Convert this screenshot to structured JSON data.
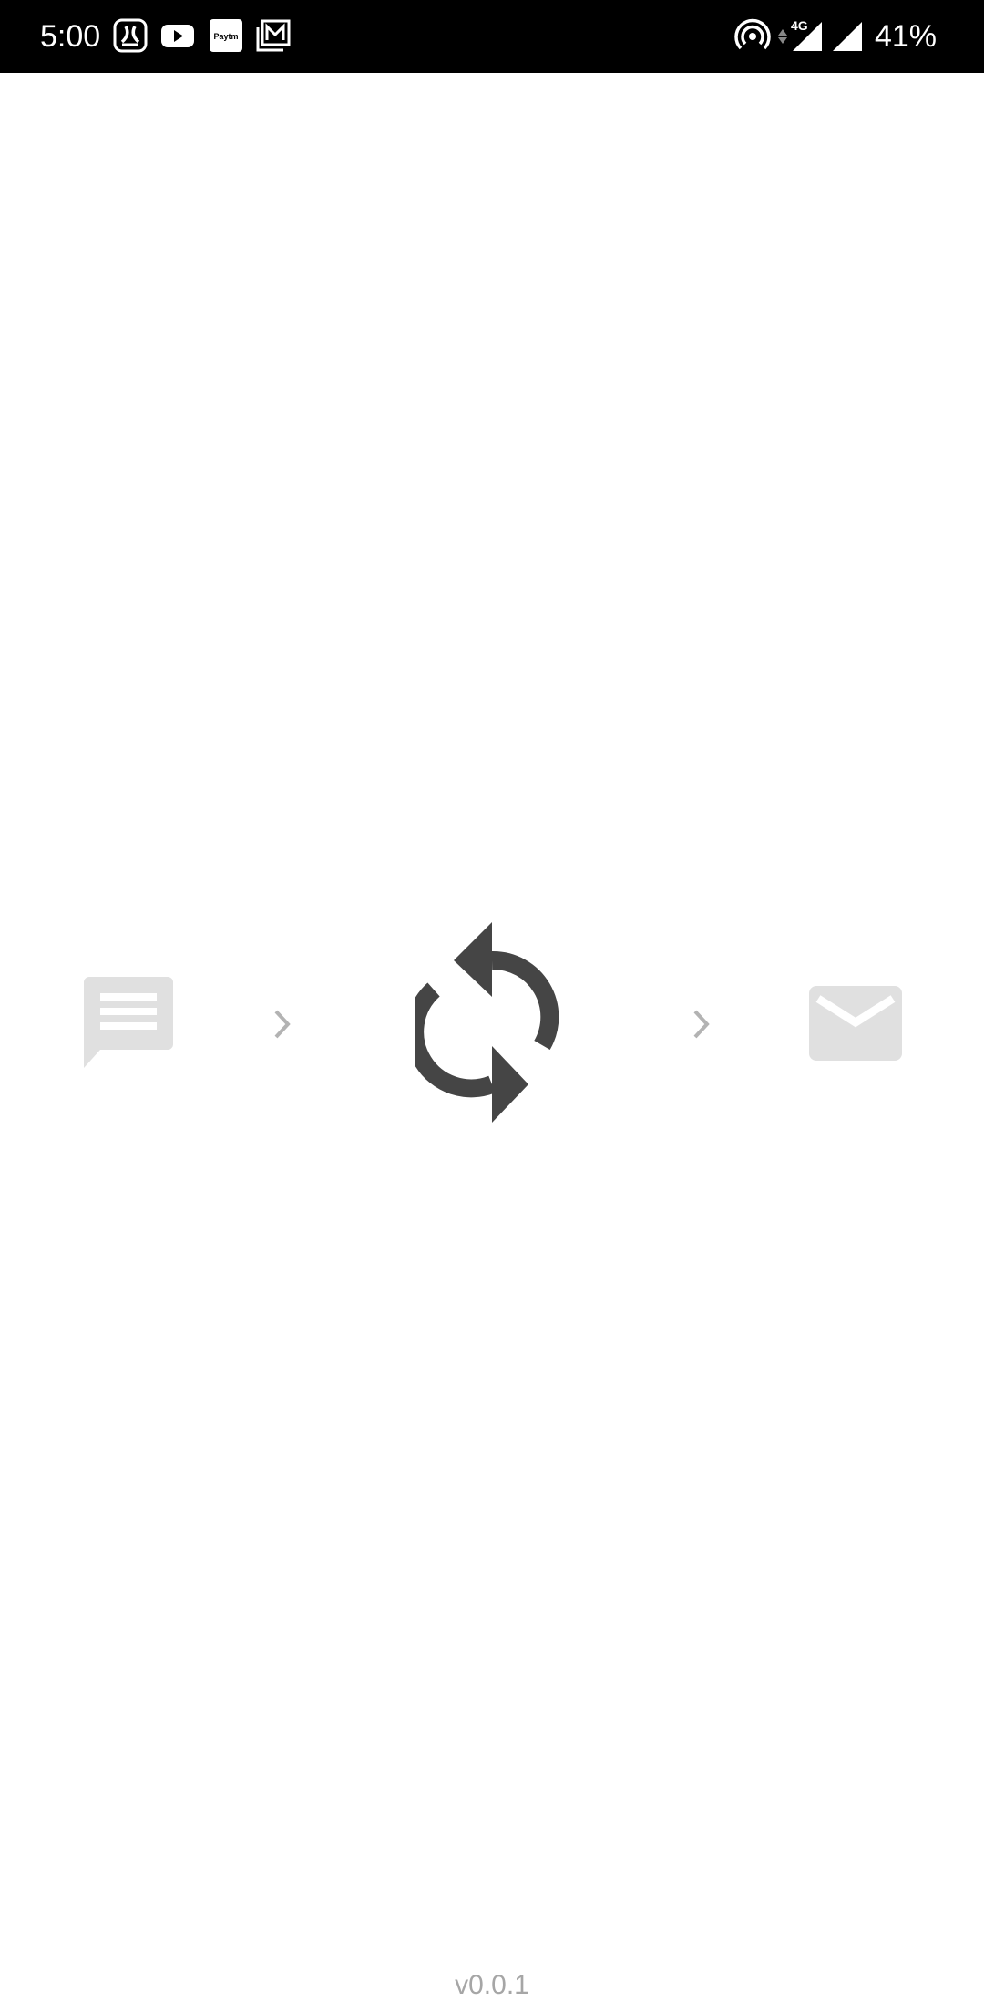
{
  "status_bar": {
    "time": "5:00",
    "notification_icons": [
      "saavn-icon",
      "youtube-icon",
      "paytm-icon",
      "gallery-icon"
    ],
    "paytm_label": "Paytm",
    "network_label": "4G",
    "battery": "41%"
  },
  "flow": {
    "source_icon": "sms-message-icon",
    "process_icon": "sync-icon",
    "target_icon": "mail-icon",
    "inactive_color": "#e0e0e0",
    "active_color": "#454545",
    "arrow_color": "#b3b3b3"
  },
  "footer": {
    "version": "v0.0.1"
  }
}
